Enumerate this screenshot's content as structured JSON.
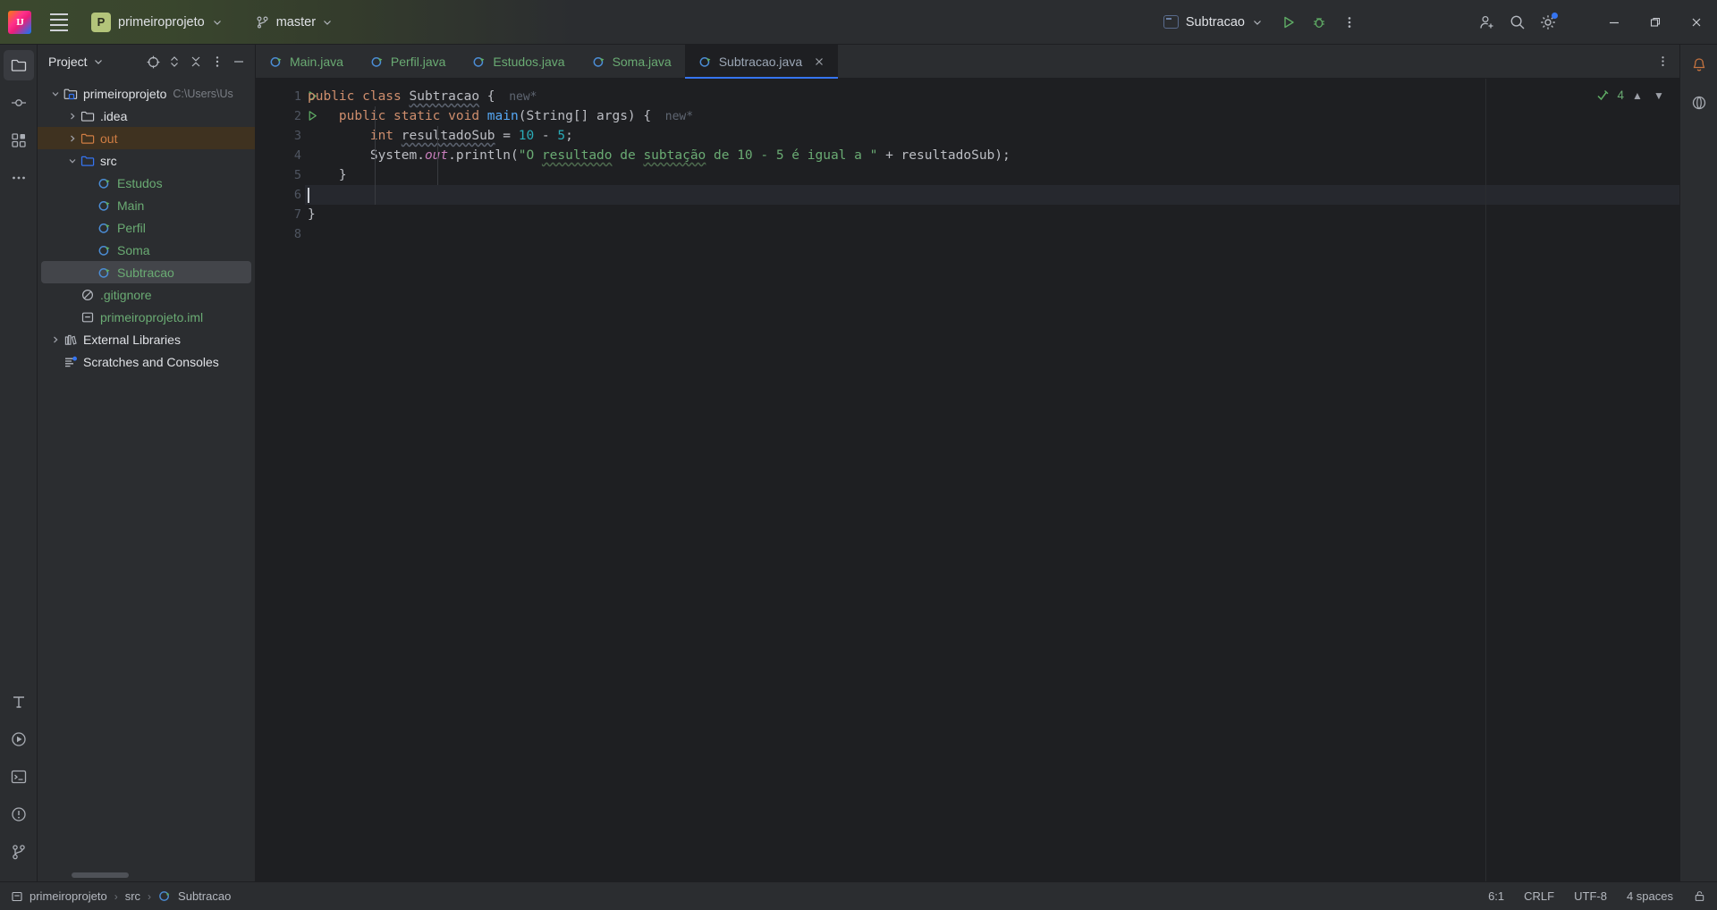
{
  "titlebar": {
    "logo_icon": "intellij-logo-icon",
    "logo_letters": "IJ",
    "menu_icon": "hamburger-menu-icon",
    "project_badge": "P",
    "project_name": "primeiroprojeto",
    "project_chevron_icon": "chevron-down-icon",
    "vcs_icon": "git-branch-icon",
    "branch_name": "master",
    "branch_chevron_icon": "chevron-down-icon",
    "run_config_icon": "run-config-icon",
    "run_config_name": "Subtracao",
    "run_config_chevron_icon": "chevron-down-icon",
    "run_icon": "run-play-icon",
    "debug_icon": "debug-bug-icon",
    "more_icon": "more-vertical-icon",
    "account_icon": "add-account-icon",
    "search_icon": "search-icon",
    "settings_icon": "gear-icon",
    "minimize_icon": "minimize-icon",
    "maximize_icon": "maximize-restore-icon",
    "close_icon": "close-icon"
  },
  "left_rail": {
    "items": [
      {
        "icon": "project-folder-icon",
        "name": "rail-project",
        "active": true
      },
      {
        "icon": "commit-icon",
        "name": "rail-commit",
        "active": false
      },
      {
        "icon": "structure-icon",
        "name": "rail-structure",
        "active": false
      },
      {
        "icon": "more-tools-icon",
        "name": "rail-more",
        "active": false
      }
    ],
    "bottom_items": [
      {
        "icon": "typography-icon",
        "name": "rail-ai-assistant"
      },
      {
        "icon": "run-tool-icon",
        "name": "rail-run"
      },
      {
        "icon": "terminal-icon",
        "name": "rail-terminal"
      },
      {
        "icon": "problems-icon",
        "name": "rail-problems"
      },
      {
        "icon": "version-control-icon",
        "name": "rail-version-control"
      }
    ]
  },
  "project_panel": {
    "title": "Project",
    "title_chevron_icon": "chevron-down-icon",
    "tools": [
      {
        "icon": "select-opened-file-icon",
        "name": "select-opened-file-button"
      },
      {
        "icon": "expand-collapse-icon",
        "name": "expand-all-button"
      },
      {
        "icon": "collapse-all-icon",
        "name": "collapse-all-button"
      },
      {
        "icon": "more-options-icon",
        "name": "panel-options-button"
      },
      {
        "icon": "hide-panel-icon",
        "name": "hide-panel-button"
      }
    ],
    "tree": [
      {
        "label": "primeiroprojeto",
        "sub": "C:\\Users\\Us",
        "indent": 0,
        "twist": "down",
        "icon": "project-root-icon",
        "style": "plain",
        "state": "normal"
      },
      {
        "label": ".idea",
        "sub": "",
        "indent": 1,
        "twist": "right",
        "icon": "folder-icon",
        "style": "plain",
        "state": "normal"
      },
      {
        "label": "out",
        "sub": "",
        "indent": 1,
        "twist": "right",
        "icon": "folder-excluded-icon",
        "style": "orange",
        "state": "highlight"
      },
      {
        "label": "src",
        "sub": "",
        "indent": 1,
        "twist": "down",
        "icon": "folder-source-icon",
        "style": "plain",
        "state": "normal"
      },
      {
        "label": "Estudos",
        "sub": "",
        "indent": 2,
        "twist": "none",
        "icon": "java-class-icon",
        "style": "green",
        "state": "normal"
      },
      {
        "label": "Main",
        "sub": "",
        "indent": 2,
        "twist": "none",
        "icon": "java-class-icon",
        "style": "green",
        "state": "normal"
      },
      {
        "label": "Perfil",
        "sub": "",
        "indent": 2,
        "twist": "none",
        "icon": "java-class-icon",
        "style": "green",
        "state": "normal"
      },
      {
        "label": "Soma",
        "sub": "",
        "indent": 2,
        "twist": "none",
        "icon": "java-class-icon",
        "style": "green",
        "state": "normal"
      },
      {
        "label": "Subtracao",
        "sub": "",
        "indent": 2,
        "twist": "none",
        "icon": "java-class-icon",
        "style": "green",
        "state": "selected"
      },
      {
        "label": ".gitignore",
        "sub": "",
        "indent": 1,
        "twist": "none",
        "icon": "gitignore-icon",
        "style": "green",
        "state": "normal"
      },
      {
        "label": "primeiroprojeto.iml",
        "sub": "",
        "indent": 1,
        "twist": "none",
        "icon": "iml-file-icon",
        "style": "green",
        "state": "normal"
      },
      {
        "label": "External Libraries",
        "sub": "",
        "indent": 0,
        "twist": "right",
        "icon": "libraries-icon",
        "style": "plain",
        "state": "normal"
      },
      {
        "label": "Scratches and Consoles",
        "sub": "",
        "indent": 0,
        "twist": "none",
        "icon": "scratches-icon",
        "style": "plain",
        "state": "normal"
      }
    ]
  },
  "tabs": {
    "items": [
      {
        "label": "Main.java",
        "icon": "java-class-icon",
        "active": false,
        "closable": false
      },
      {
        "label": "Perfil.java",
        "icon": "java-class-icon",
        "active": false,
        "closable": false
      },
      {
        "label": "Estudos.java",
        "icon": "java-class-icon",
        "active": false,
        "closable": false
      },
      {
        "label": "Soma.java",
        "icon": "java-class-icon",
        "active": false,
        "closable": false
      },
      {
        "label": "Subtracao.java",
        "icon": "java-class-icon",
        "active": true,
        "closable": true
      }
    ],
    "close_icon": "close-icon",
    "options_icon": "more-vertical-icon"
  },
  "editor": {
    "line_numbers": [
      "1",
      "2",
      "3",
      "4",
      "5",
      "6",
      "7",
      "8"
    ],
    "run_marker_lines": [
      1,
      2
    ],
    "run_marker_icon": "run-gutter-icon",
    "caret_line": 6,
    "inspection": {
      "status_icon": "inspection-ok-icon",
      "count": "4",
      "up_icon": "chevron-up-icon",
      "down_icon": "chevron-down-icon"
    },
    "code_lines": [
      {
        "num": "1",
        "tokens": [
          {
            "t": "public ",
            "c": "kw"
          },
          {
            "t": "class ",
            "c": "kw"
          },
          {
            "t": "Subtracao",
            "c": "wavy"
          },
          {
            "t": " {",
            "c": "plain"
          },
          {
            "t": "  new*",
            "c": "hint"
          }
        ]
      },
      {
        "num": "2",
        "tokens": [
          {
            "t": "    ",
            "c": "plain"
          },
          {
            "t": "public static void ",
            "c": "kw"
          },
          {
            "t": "main",
            "c": "mth"
          },
          {
            "t": "(String[] args) {",
            "c": "plain"
          },
          {
            "t": "  new*",
            "c": "hint"
          }
        ]
      },
      {
        "num": "3",
        "tokens": [
          {
            "t": "        ",
            "c": "plain"
          },
          {
            "t": "int ",
            "c": "kw"
          },
          {
            "t": "resultadoSub",
            "c": "wavy"
          },
          {
            "t": " = ",
            "c": "plain"
          },
          {
            "t": "10",
            "c": "num"
          },
          {
            "t": " - ",
            "c": "plain"
          },
          {
            "t": "5",
            "c": "num"
          },
          {
            "t": ";",
            "c": "plain"
          }
        ]
      },
      {
        "num": "4",
        "tokens": [
          {
            "t": "        System.",
            "c": "plain"
          },
          {
            "t": "out",
            "c": "fld"
          },
          {
            "t": ".println(",
            "c": "plain"
          },
          {
            "t": "\"O ",
            "c": "str"
          },
          {
            "t": "resultado",
            "c": "str-wavy"
          },
          {
            "t": " de ",
            "c": "str"
          },
          {
            "t": "subtação",
            "c": "str-wavy"
          },
          {
            "t": " de 10 - 5 é igual a \"",
            "c": "str"
          },
          {
            "t": " + resultadoSub);",
            "c": "plain"
          }
        ]
      },
      {
        "num": "5",
        "tokens": [
          {
            "t": "    }",
            "c": "plain"
          }
        ]
      },
      {
        "num": "6",
        "tokens": [],
        "caret": true
      },
      {
        "num": "7",
        "tokens": [
          {
            "t": "}",
            "c": "plain"
          }
        ]
      },
      {
        "num": "8",
        "tokens": []
      }
    ]
  },
  "right_rail": {
    "items": [
      {
        "icon": "notifications-bell-icon",
        "name": "rail-notifications"
      },
      {
        "icon": "ai-assistant-icon",
        "name": "rail-ai"
      }
    ]
  },
  "statusbar": {
    "breadcrumb": [
      {
        "label": "primeiroprojeto",
        "icon": "module-icon"
      },
      {
        "label": "src",
        "icon": ""
      },
      {
        "label": "Subtracao",
        "icon": "java-class-icon"
      }
    ],
    "separator": "›",
    "caret_position": "6:1",
    "line_separator": "CRLF",
    "encoding": "UTF-8",
    "indent": "4 spaces",
    "lock_icon": "unlocked-icon"
  },
  "colors": {
    "accent": "#3574f0",
    "keyword": "#cf8e6d",
    "string": "#6aab73",
    "number": "#2aacb8",
    "method": "#56a8f5",
    "field": "#c77dbb",
    "titlebar_green": "#3c4a2e",
    "panel_bg": "#2b2d30",
    "editor_bg": "#1e1f22"
  }
}
